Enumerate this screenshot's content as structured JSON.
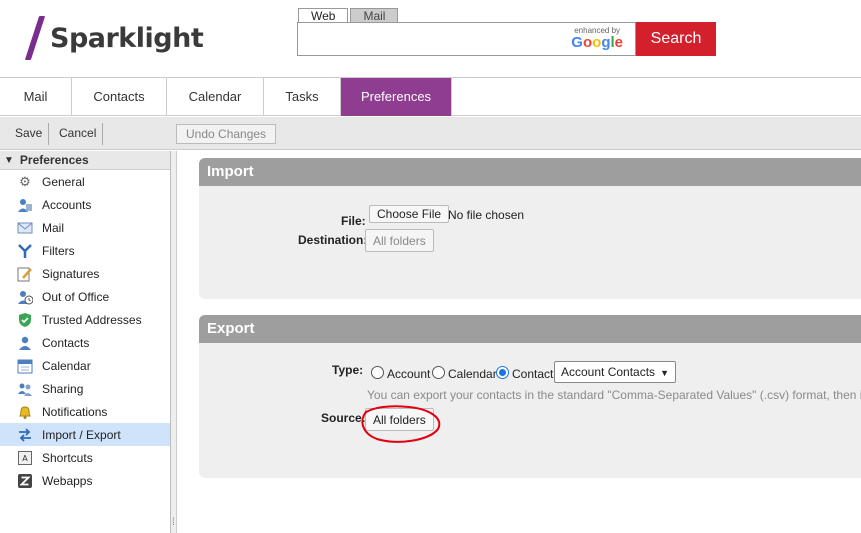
{
  "brand": {
    "name": "Sparklight"
  },
  "search": {
    "tabs": [
      {
        "label": "Web"
      },
      {
        "label": "Mail"
      }
    ],
    "enhanced_by": "enhanced by",
    "google": "Google",
    "button_label": "Search",
    "value": ""
  },
  "nav": {
    "tabs": [
      {
        "label": "Mail"
      },
      {
        "label": "Contacts"
      },
      {
        "label": "Calendar"
      },
      {
        "label": "Tasks"
      },
      {
        "label": "Preferences"
      }
    ]
  },
  "toolbar": {
    "save": "Save",
    "cancel": "Cancel",
    "undo": "Undo Changes"
  },
  "sidebar": {
    "header": "Preferences",
    "items": [
      {
        "label": "General",
        "icon": "gear-icon"
      },
      {
        "label": "Accounts",
        "icon": "accounts-icon"
      },
      {
        "label": "Mail",
        "icon": "envelope-icon"
      },
      {
        "label": "Filters",
        "icon": "filter-icon"
      },
      {
        "label": "Signatures",
        "icon": "signature-icon"
      },
      {
        "label": "Out of Office",
        "icon": "out-of-office-icon"
      },
      {
        "label": "Trusted Addresses",
        "icon": "shield-check-icon"
      },
      {
        "label": "Contacts",
        "icon": "contact-icon"
      },
      {
        "label": "Calendar",
        "icon": "calendar-icon"
      },
      {
        "label": "Sharing",
        "icon": "sharing-icon"
      },
      {
        "label": "Notifications",
        "icon": "bell-icon"
      },
      {
        "label": "Import / Export",
        "icon": "import-export-icon"
      },
      {
        "label": "Shortcuts",
        "icon": "keyboard-icon"
      },
      {
        "label": "Webapps",
        "icon": "zimbra-icon"
      }
    ]
  },
  "import": {
    "title": "Import",
    "file_label": "File:",
    "choose_file": "Choose File",
    "no_file": "No file chosen",
    "destination_label": "Destination:",
    "destination_button": "All folders"
  },
  "export": {
    "title": "Export",
    "type_label": "Type:",
    "types": [
      {
        "label": "Account",
        "checked": false
      },
      {
        "label": "Calendar",
        "checked": false
      },
      {
        "label": "Contacts",
        "checked": true
      }
    ],
    "format_select": "Account Contacts",
    "hint": "You can export your contacts in the standard \"Comma-Separated Values\" (.csv) format, then import the",
    "source_label": "Source:",
    "source_button": "All folders"
  },
  "colors": {
    "brand_purple": "#8e3d91",
    "search_red": "#d4202c",
    "selected_blue": "#cfe3fb",
    "annotation_red": "#e0000f"
  }
}
